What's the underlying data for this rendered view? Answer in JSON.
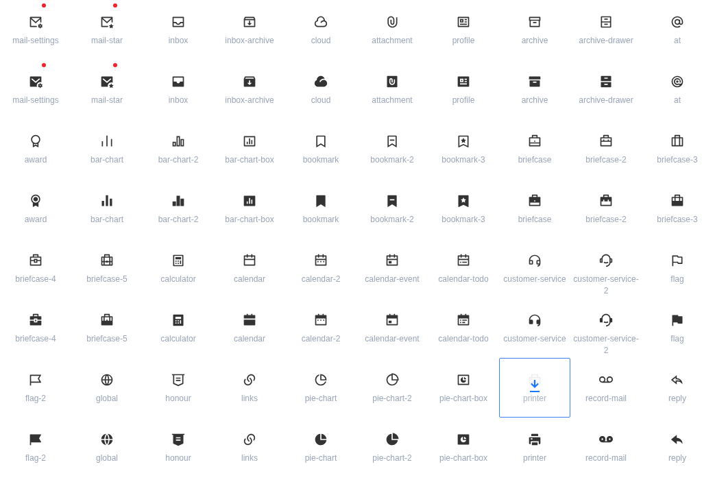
{
  "rows": [
    {
      "kind": "line",
      "items": [
        {
          "label": "mail-settings",
          "dot": true,
          "selected": false
        },
        {
          "label": "mail-star",
          "dot": true,
          "selected": false
        },
        {
          "label": "inbox",
          "dot": false,
          "selected": false
        },
        {
          "label": "inbox-archive",
          "dot": false,
          "selected": false
        },
        {
          "label": "cloud",
          "dot": false,
          "selected": false
        },
        {
          "label": "attachment",
          "dot": false,
          "selected": false
        },
        {
          "label": "profile",
          "dot": false,
          "selected": false
        },
        {
          "label": "archive",
          "dot": false,
          "selected": false
        },
        {
          "label": "archive-drawer",
          "dot": false,
          "selected": false
        },
        {
          "label": "at",
          "dot": false,
          "selected": false
        }
      ]
    },
    {
      "kind": "fill",
      "items": [
        {
          "label": "mail-settings",
          "dot": true,
          "selected": false
        },
        {
          "label": "mail-star",
          "dot": true,
          "selected": false
        },
        {
          "label": "inbox",
          "dot": false,
          "selected": false
        },
        {
          "label": "inbox-archive",
          "dot": false,
          "selected": false
        },
        {
          "label": "cloud",
          "dot": false,
          "selected": false
        },
        {
          "label": "attachment",
          "dot": false,
          "selected": false
        },
        {
          "label": "profile",
          "dot": false,
          "selected": false
        },
        {
          "label": "archive",
          "dot": false,
          "selected": false
        },
        {
          "label": "archive-drawer",
          "dot": false,
          "selected": false
        },
        {
          "label": "at",
          "dot": false,
          "selected": false
        }
      ]
    },
    {
      "kind": "line",
      "items": [
        {
          "label": "award",
          "dot": false,
          "selected": false
        },
        {
          "label": "bar-chart",
          "dot": false,
          "selected": false
        },
        {
          "label": "bar-chart-2",
          "dot": false,
          "selected": false
        },
        {
          "label": "bar-chart-box",
          "dot": false,
          "selected": false
        },
        {
          "label": "bookmark",
          "dot": false,
          "selected": false
        },
        {
          "label": "bookmark-2",
          "dot": false,
          "selected": false
        },
        {
          "label": "bookmark-3",
          "dot": false,
          "selected": false
        },
        {
          "label": "briefcase",
          "dot": false,
          "selected": false
        },
        {
          "label": "briefcase-2",
          "dot": false,
          "selected": false
        },
        {
          "label": "briefcase-3",
          "dot": false,
          "selected": false
        }
      ]
    },
    {
      "kind": "fill",
      "items": [
        {
          "label": "award",
          "dot": false,
          "selected": false
        },
        {
          "label": "bar-chart",
          "dot": false,
          "selected": false
        },
        {
          "label": "bar-chart-2",
          "dot": false,
          "selected": false
        },
        {
          "label": "bar-chart-box",
          "dot": false,
          "selected": false
        },
        {
          "label": "bookmark",
          "dot": false,
          "selected": false
        },
        {
          "label": "bookmark-2",
          "dot": false,
          "selected": false
        },
        {
          "label": "bookmark-3",
          "dot": false,
          "selected": false
        },
        {
          "label": "briefcase",
          "dot": false,
          "selected": false
        },
        {
          "label": "briefcase-2",
          "dot": false,
          "selected": false
        },
        {
          "label": "briefcase-3",
          "dot": false,
          "selected": false
        }
      ]
    },
    {
      "kind": "line",
      "items": [
        {
          "label": "briefcase-4",
          "dot": false,
          "selected": false
        },
        {
          "label": "briefcase-5",
          "dot": false,
          "selected": false
        },
        {
          "label": "calculator",
          "dot": false,
          "selected": false
        },
        {
          "label": "calendar",
          "dot": false,
          "selected": false
        },
        {
          "label": "calendar-2",
          "dot": false,
          "selected": false
        },
        {
          "label": "calendar-event",
          "dot": false,
          "selected": false
        },
        {
          "label": "calendar-todo",
          "dot": false,
          "selected": false
        },
        {
          "label": "customer-service",
          "dot": false,
          "selected": false
        },
        {
          "label": "customer-service-2",
          "dot": false,
          "selected": false
        },
        {
          "label": "flag",
          "dot": false,
          "selected": false
        }
      ]
    },
    {
      "kind": "fill",
      "items": [
        {
          "label": "briefcase-4",
          "dot": false,
          "selected": false
        },
        {
          "label": "briefcase-5",
          "dot": false,
          "selected": false
        },
        {
          "label": "calculator",
          "dot": false,
          "selected": false
        },
        {
          "label": "calendar",
          "dot": false,
          "selected": false
        },
        {
          "label": "calendar-2",
          "dot": false,
          "selected": false
        },
        {
          "label": "calendar-event",
          "dot": false,
          "selected": false
        },
        {
          "label": "calendar-todo",
          "dot": false,
          "selected": false
        },
        {
          "label": "customer-service",
          "dot": false,
          "selected": false
        },
        {
          "label": "customer-service-2",
          "dot": false,
          "selected": false
        },
        {
          "label": "flag",
          "dot": false,
          "selected": false
        }
      ]
    },
    {
      "kind": "line",
      "items": [
        {
          "label": "flag-2",
          "dot": false,
          "selected": false
        },
        {
          "label": "global",
          "dot": false,
          "selected": false
        },
        {
          "label": "honour",
          "dot": false,
          "selected": false
        },
        {
          "label": "links",
          "dot": false,
          "selected": false
        },
        {
          "label": "pie-chart",
          "dot": false,
          "selected": false
        },
        {
          "label": "pie-chart-2",
          "dot": false,
          "selected": false
        },
        {
          "label": "pie-chart-box",
          "dot": false,
          "selected": false
        },
        {
          "label": "printer",
          "dot": false,
          "selected": true
        },
        {
          "label": "record-mail",
          "dot": false,
          "selected": false
        },
        {
          "label": "reply",
          "dot": false,
          "selected": false
        }
      ]
    },
    {
      "kind": "fill",
      "items": [
        {
          "label": "flag-2",
          "dot": false,
          "selected": false
        },
        {
          "label": "global",
          "dot": false,
          "selected": false
        },
        {
          "label": "honour",
          "dot": false,
          "selected": false
        },
        {
          "label": "links",
          "dot": false,
          "selected": false
        },
        {
          "label": "pie-chart",
          "dot": false,
          "selected": false
        },
        {
          "label": "pie-chart-2",
          "dot": false,
          "selected": false
        },
        {
          "label": "pie-chart-box",
          "dot": false,
          "selected": false
        },
        {
          "label": "printer",
          "dot": false,
          "selected": false
        },
        {
          "label": "record-mail",
          "dot": false,
          "selected": false
        },
        {
          "label": "reply",
          "dot": false,
          "selected": false
        }
      ]
    }
  ]
}
